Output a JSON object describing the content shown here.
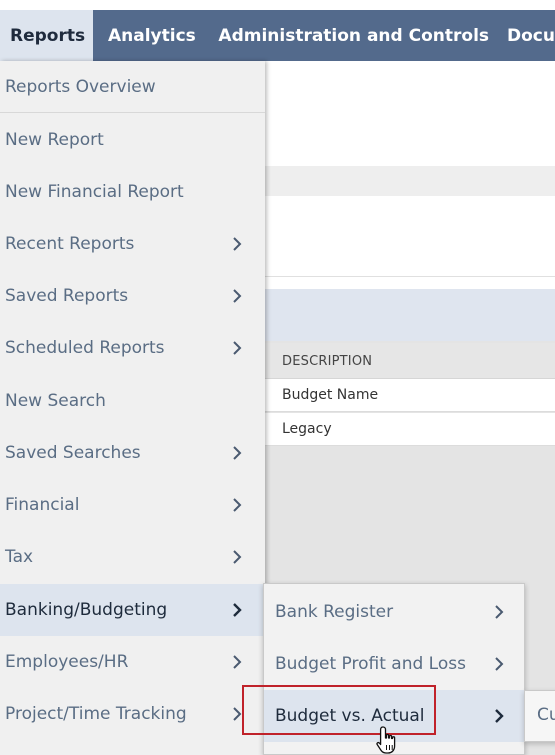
{
  "topnav": {
    "tabs": [
      {
        "label": "Reports",
        "active": true
      },
      {
        "label": "Analytics"
      },
      {
        "label": "Administration and Controls"
      },
      {
        "label": "Docu"
      }
    ]
  },
  "menu": {
    "items": [
      {
        "label": "Reports Overview",
        "has_submenu": false
      },
      {
        "label": "New Report",
        "has_submenu": false
      },
      {
        "label": "New Financial Report",
        "has_submenu": false
      },
      {
        "label": "Recent Reports",
        "has_submenu": true
      },
      {
        "label": "Saved Reports",
        "has_submenu": true
      },
      {
        "label": "Scheduled Reports",
        "has_submenu": true
      },
      {
        "label": "New Search",
        "has_submenu": false
      },
      {
        "label": "Saved Searches",
        "has_submenu": true
      },
      {
        "label": "Financial",
        "has_submenu": true
      },
      {
        "label": "Tax",
        "has_submenu": true
      },
      {
        "label": "Banking/Budgeting",
        "has_submenu": true,
        "active": true
      },
      {
        "label": "Employees/HR",
        "has_submenu": true
      },
      {
        "label": "Project/Time Tracking",
        "has_submenu": true
      }
    ]
  },
  "submenu": {
    "items": [
      {
        "label": "Bank Register",
        "has_submenu": true
      },
      {
        "label": "Budget Profit and Loss",
        "has_submenu": true
      },
      {
        "label": "Budget vs. Actual",
        "has_submenu": true,
        "active": true
      }
    ]
  },
  "submenu2": {
    "partial_label": "Cu"
  },
  "page": {
    "table": {
      "header": "DESCRIPTION",
      "rows": [
        "Budget Name",
        "Legacy"
      ]
    }
  },
  "colors": {
    "navbar": "#536a8c",
    "active_bg": "#dde4ee",
    "menu_text": "#5a6d84",
    "highlight": "#c0222a"
  },
  "icons": {
    "submenu_indicator": "chevron-right-icon",
    "cursor": "hand-pointer-icon"
  }
}
